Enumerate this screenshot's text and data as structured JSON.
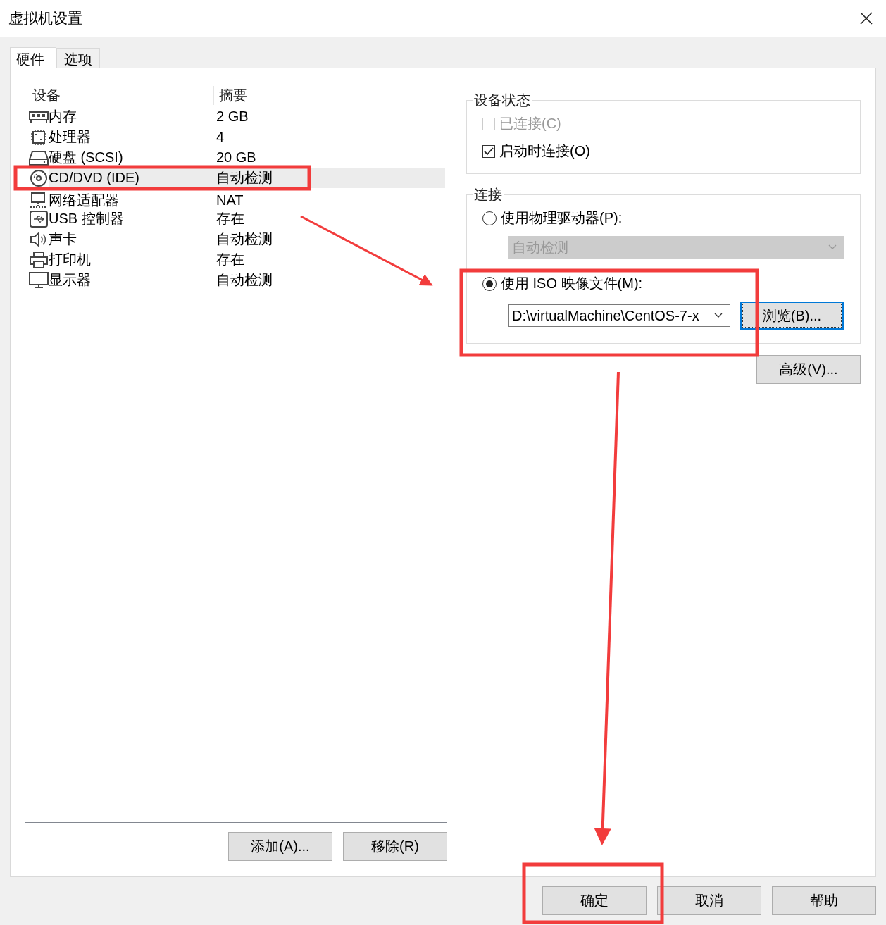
{
  "window": {
    "title": "虚拟机设置"
  },
  "tabs": [
    {
      "label": "硬件",
      "selected": true
    },
    {
      "label": "选项",
      "selected": false
    }
  ],
  "device_list": {
    "columns": [
      "设备",
      "摘要"
    ],
    "rows": [
      {
        "kind": "memory",
        "device": "内存",
        "summary": "2 GB",
        "selected": false
      },
      {
        "kind": "cpu",
        "device": "处理器",
        "summary": "4",
        "selected": false
      },
      {
        "kind": "disk",
        "device": "硬盘 (SCSI)",
        "summary": "20 GB",
        "selected": false
      },
      {
        "kind": "cd",
        "device": "CD/DVD (IDE)",
        "summary": "自动检测",
        "selected": true
      },
      {
        "kind": "network",
        "device": "网络适配器",
        "summary": "NAT",
        "selected": false
      },
      {
        "kind": "usb",
        "device": "USB 控制器",
        "summary": "存在",
        "selected": false
      },
      {
        "kind": "sound",
        "device": "声卡",
        "summary": "自动检测",
        "selected": false
      },
      {
        "kind": "printer",
        "device": "打印机",
        "summary": "存在",
        "selected": false
      },
      {
        "kind": "display",
        "device": "显示器",
        "summary": "自动检测",
        "selected": false
      }
    ]
  },
  "list_buttons": [
    "添加(A)...",
    "移除(R)"
  ],
  "device_status": {
    "title": "设备状态",
    "options": [
      {
        "label": "已连接(C)",
        "checked": false,
        "disabled": true
      },
      {
        "label": "启动时连接(O)",
        "checked": true,
        "disabled": false
      }
    ]
  },
  "connection": {
    "title": "连接",
    "options": [
      {
        "kind": "physical",
        "label": "使用物理驱动器(P):",
        "selected": false,
        "field": {
          "value": "自动检测",
          "disabled": true
        }
      },
      {
        "kind": "iso",
        "label": "使用 ISO 映像文件(M):",
        "selected": true,
        "field": {
          "value": "D:\\virtualMachine\\CentOS-7-x",
          "disabled": false
        },
        "browse_button": "浏览(B)..."
      }
    ]
  },
  "advanced_button": "高级(V)...",
  "footer_buttons": [
    "确定",
    "取消",
    "帮助"
  ]
}
